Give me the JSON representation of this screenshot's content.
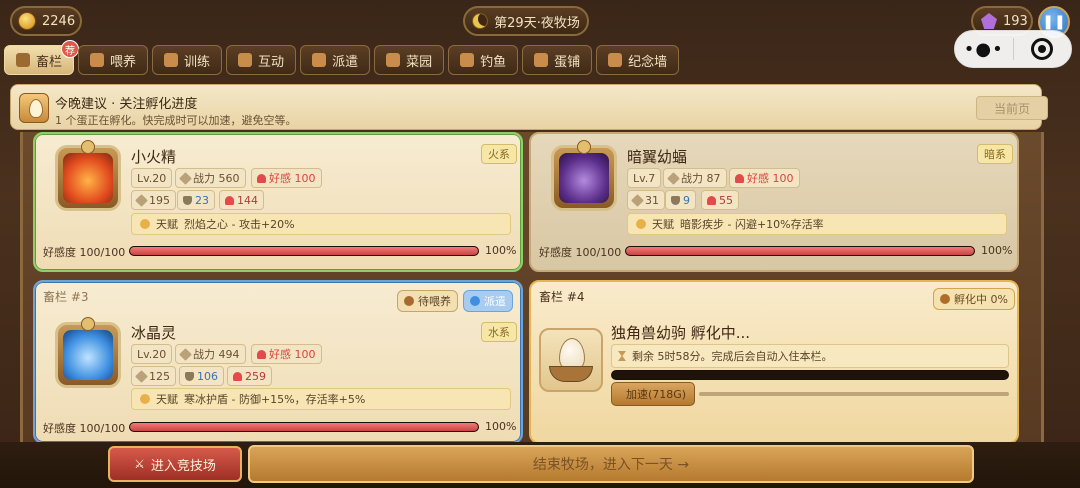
{
  "top": {
    "coins": "2246",
    "day": "第29天·夜牧场",
    "gems": "193",
    "pause_icon": "pause-icon",
    "capsule_menu": "•●•"
  },
  "tabs": [
    {
      "label": "畜栏",
      "icon": "barn-icon",
      "active": true,
      "badge": "荐"
    },
    {
      "label": "喂养",
      "icon": "feed-icon"
    },
    {
      "label": "训练",
      "icon": "train-icon"
    },
    {
      "label": "互动",
      "icon": "heart-icon"
    },
    {
      "label": "派遣",
      "icon": "dispatch-icon"
    },
    {
      "label": "菜园",
      "icon": "garden-icon"
    },
    {
      "label": "钓鱼",
      "icon": "fishing-icon"
    },
    {
      "label": "蛋铺",
      "icon": "egg-shop-icon"
    },
    {
      "label": "纪念墙",
      "icon": "memorial-icon"
    }
  ],
  "advice": {
    "title": "今晚建议 · 关注孵化进度",
    "desc": "1 个蛋正在孵化。快完成时可以加速，避免空等。",
    "current_page": "当前页"
  },
  "pens": {
    "p1": {
      "name": "小火精",
      "element": "火系",
      "level": "Lv.20",
      "power": "战力 560",
      "affection": "好感 100",
      "atk": "195",
      "def": "23",
      "hp": "144",
      "talent_label": "天赋",
      "talent": "烈焰之心 - 攻击+20%",
      "aff_label": "好感度 100/100",
      "aff_pct": "100%",
      "aff_value": 1.0
    },
    "p2": {
      "name": "暗翼幼蝠",
      "element": "暗系",
      "level": "Lv.7",
      "power": "战力 87",
      "affection": "好感 100",
      "atk": "31",
      "def": "9",
      "hp": "55",
      "talent_label": "天赋",
      "talent": "暗影疾步 - 闪避+10%存活率",
      "aff_label": "好感度 100/100",
      "aff_pct": "100%",
      "aff_value": 1.0
    },
    "p3": {
      "pen_label": "畜栏 #3",
      "feed_tag": "待喂养",
      "status_tag": "派遣",
      "name": "冰晶灵",
      "element": "水系",
      "level": "Lv.20",
      "power": "战力 494",
      "affection": "好感 100",
      "atk": "125",
      "def": "106",
      "hp": "259",
      "talent_label": "天赋",
      "talent": "寒冰护盾 - 防御+15%，存活率+5%",
      "aff_label": "好感度 100/100",
      "aff_pct": "100%",
      "aff_value": 1.0
    },
    "p4": {
      "pen_label": "畜栏 #4",
      "hatch_tag": "孵化中 0%",
      "title": "独角兽幼驹 孵化中...",
      "remain": "剩余 5时58分。完成后会自动入住本栏。",
      "speed": "加速(718G)",
      "progress": 0.0
    }
  },
  "bottom": {
    "arena": "进入竞技场",
    "end_day": "结束牧场，进入下一天 →"
  }
}
